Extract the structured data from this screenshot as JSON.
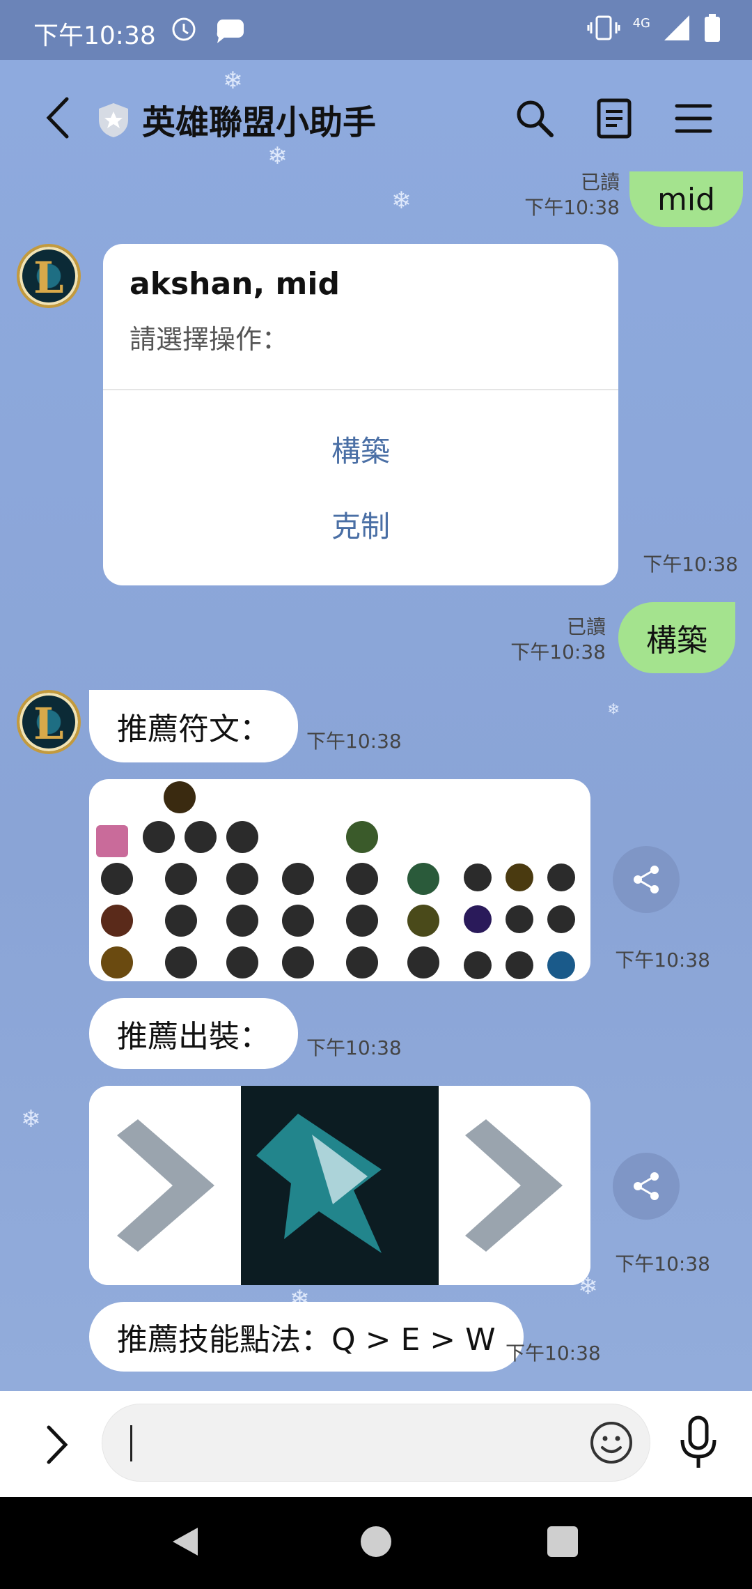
{
  "status_bar": {
    "time": "下午10:38",
    "network": "4G"
  },
  "header": {
    "title": "英雄聯盟小助手"
  },
  "messages": {
    "m1": {
      "text": "mid",
      "read": "已讀",
      "time": "下午10:38"
    },
    "card": {
      "title": "akshan, mid",
      "subtitle": "請選擇操作：",
      "action1": "構築",
      "action2": "克制",
      "time": "下午10:38"
    },
    "m2": {
      "text": "構築",
      "read": "已讀",
      "time": "下午10:38"
    },
    "m3": {
      "text": "推薦符文：",
      "time": "下午10:38"
    },
    "runes_time": "下午10:38",
    "m4": {
      "text": "推薦出裝：",
      "time": "下午10:38"
    },
    "items_time": "下午10:38",
    "m5": {
      "text": "推薦技能點法：Q > E > W",
      "time": "下午10:38"
    }
  },
  "input": {
    "placeholder": ""
  },
  "colors": {
    "chat_bg": "#8aa4d6",
    "out_bubble": "#a4e38e",
    "link": "#4a6fa5"
  }
}
